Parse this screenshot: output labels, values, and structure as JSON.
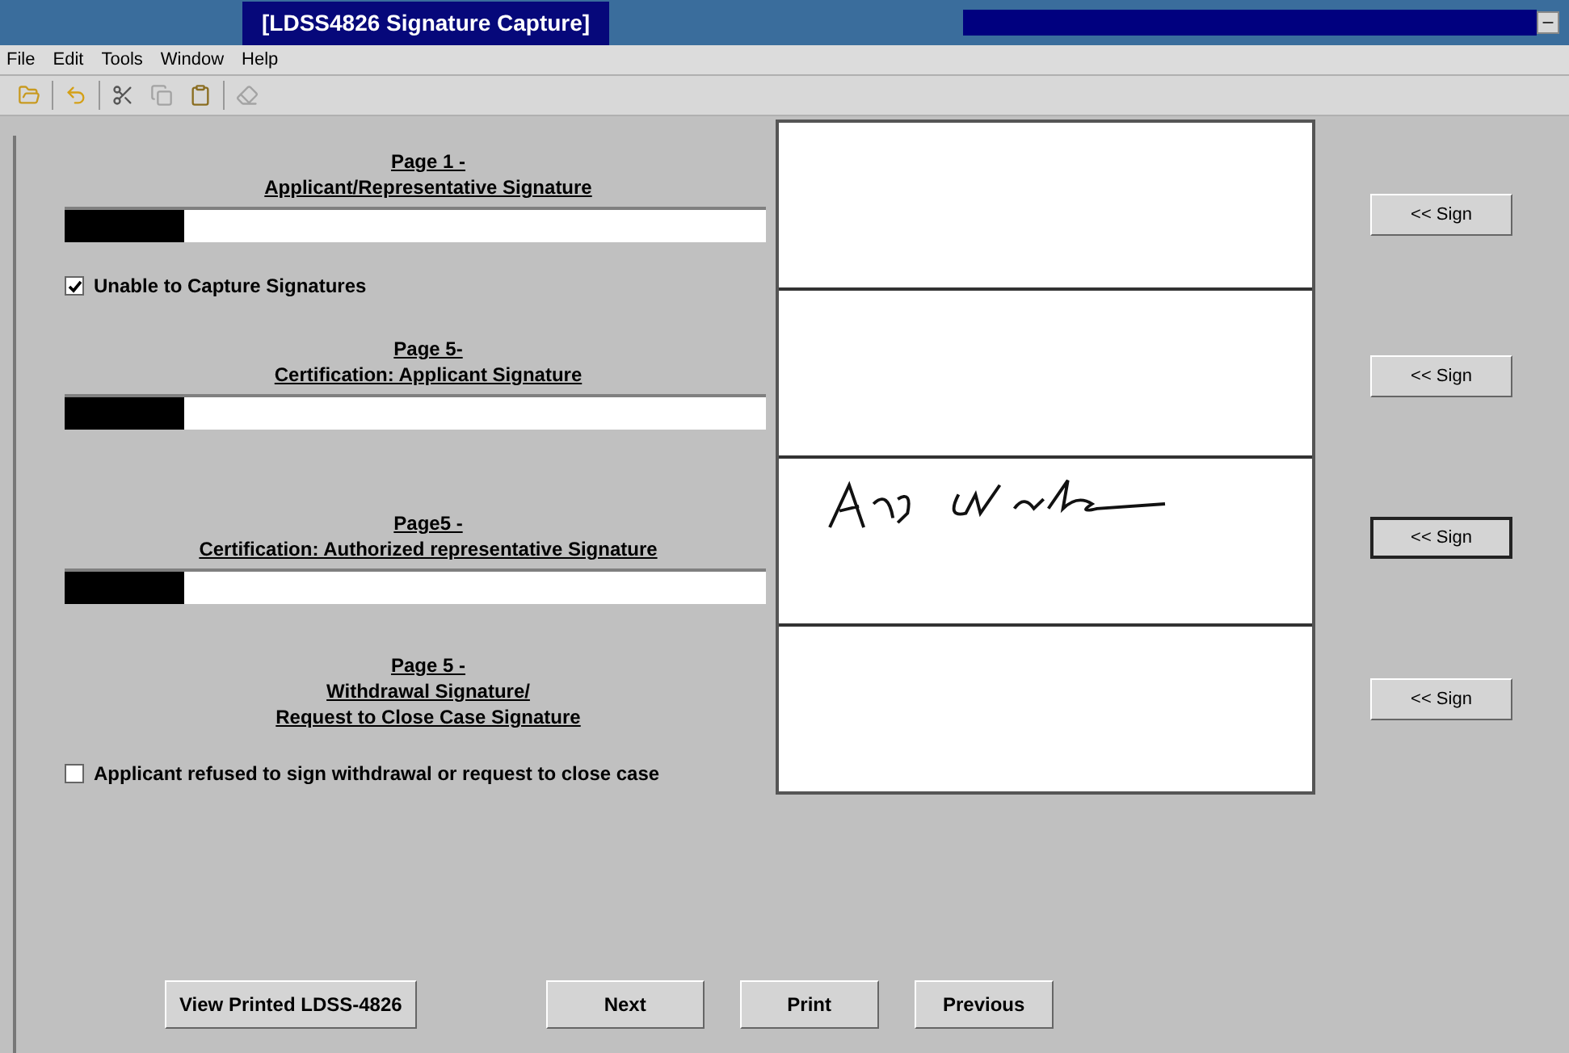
{
  "window": {
    "title": "[LDSS4826 Signature Capture]"
  },
  "menu": [
    "File",
    "Edit",
    "Tools",
    "Window",
    "Help"
  ],
  "toolbar": [
    {
      "kind": "folder",
      "disabled": false
    },
    {
      "kind": "undo",
      "disabled": false
    },
    {
      "kind": "cut",
      "disabled": false
    },
    {
      "kind": "copy",
      "disabled": true
    },
    {
      "kind": "paste",
      "disabled": false
    },
    {
      "kind": "erase",
      "disabled": true
    }
  ],
  "sections": [
    {
      "heading": [
        "Page 1 -",
        "Applicant/Representative Signature"
      ],
      "field": {
        "redacted": true
      },
      "checkbox": {
        "label": "Unable to Capture Signatures",
        "checked": true
      },
      "pane": {
        "signed": false
      },
      "sign_button": {
        "label": "<< Sign",
        "focused": false
      }
    },
    {
      "heading": [
        "Page 5-",
        "Certification: Applicant Signature"
      ],
      "field": {
        "redacted": true
      },
      "pane": {
        "signed": false
      },
      "sign_button": {
        "label": "<< Sign",
        "focused": false
      }
    },
    {
      "heading": [
        "Page5 -",
        "Certification: Authorized representative Signature"
      ],
      "field": {
        "redacted": true
      },
      "pane": {
        "signed": true
      },
      "sign_button": {
        "label": "<< Sign",
        "focused": true
      }
    },
    {
      "heading": [
        "Page 5 -",
        "Withdrawal Signature/",
        "Request to Close Case Signature"
      ],
      "checkbox": {
        "label": "Applicant refused to sign withdrawal or request to close case",
        "checked": false
      },
      "pane": {
        "signed": false
      },
      "sign_button": {
        "label": "<< Sign",
        "focused": false
      }
    }
  ],
  "buttons": [
    "View Printed LDSS-4826",
    "Next",
    "Print",
    "Previous"
  ]
}
